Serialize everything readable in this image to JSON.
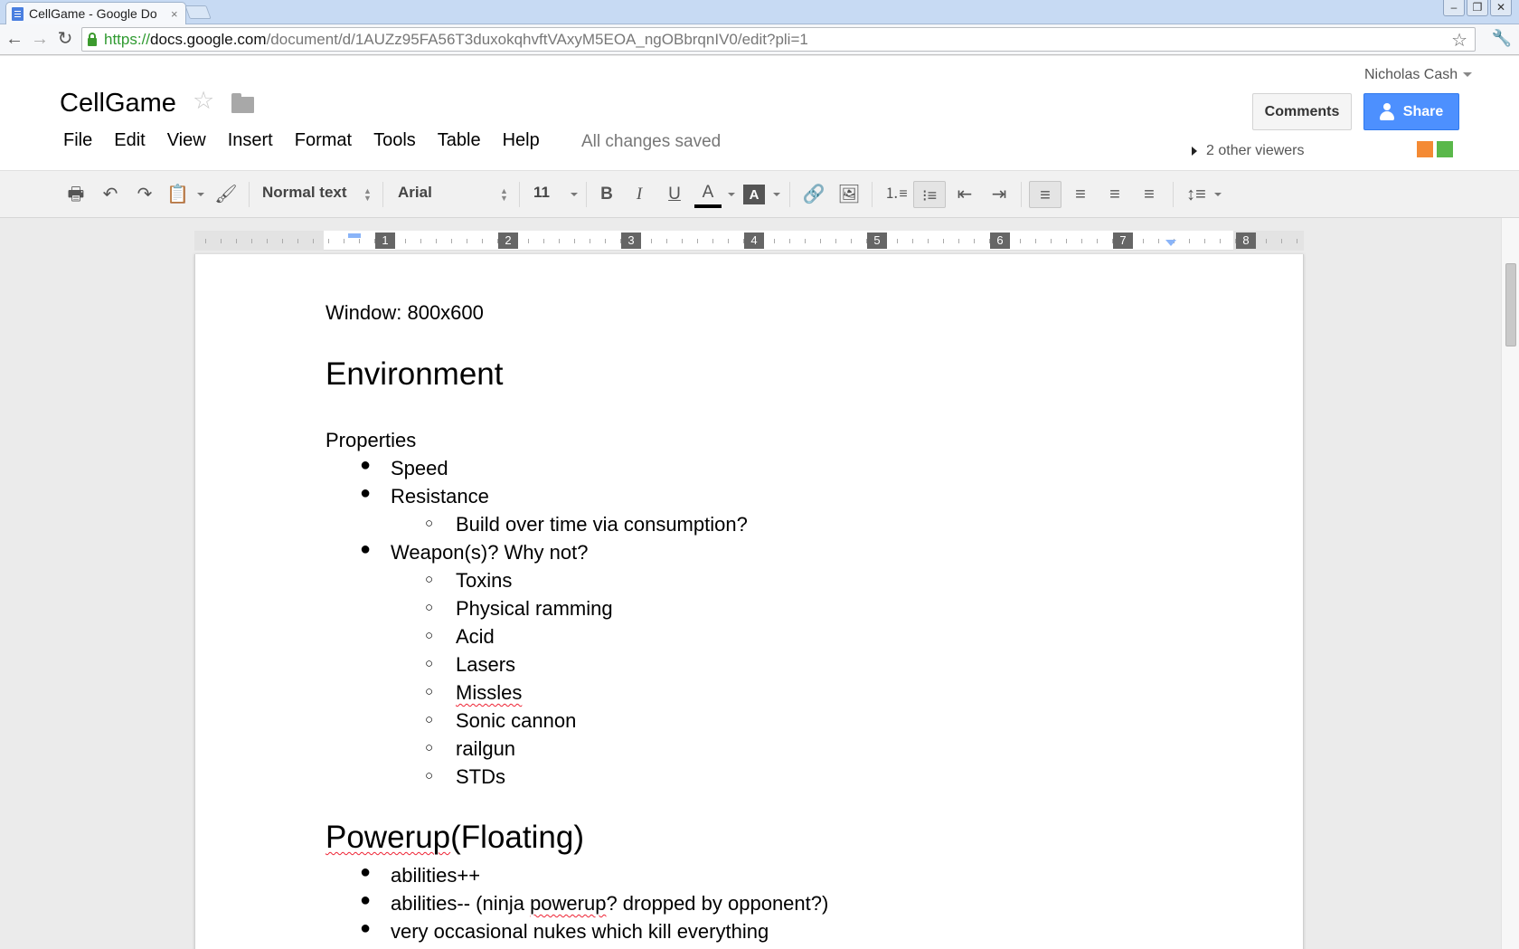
{
  "browser": {
    "tab_title": "CellGame - Google Do",
    "tab_close": "×",
    "url_scheme": "https://",
    "url_host": "docs.google.com",
    "url_path": "/document/d/1AUZz95FA56T3duxokqhvftVAxyM5EOA_ngOBbrqnIV0/edit?pli=1",
    "window_buttons": [
      "–",
      "❐",
      "✕"
    ]
  },
  "docs_header": {
    "title": "CellGame",
    "menu": [
      "File",
      "Edit",
      "View",
      "Insert",
      "Format",
      "Tools",
      "Table",
      "Help"
    ],
    "save_status": "All changes saved",
    "user_name": "Nicholas Cash",
    "comments_label": "Comments",
    "share_label": "Share",
    "viewers_label": "2 other viewers",
    "viewer_colors": [
      "#f48a34",
      "#5ab84a"
    ]
  },
  "toolbar": {
    "style_select": "Normal text",
    "font_select": "Arial",
    "size_select": "11",
    "bold_glyph": "B",
    "italic_glyph": "I",
    "underline_glyph": "U",
    "textcolor_glyph": "A",
    "highlight_glyph": "A"
  },
  "ruler": {
    "numbers": [
      "1",
      "2",
      "3",
      "4",
      "5",
      "6",
      "7",
      "8"
    ]
  },
  "document": {
    "line1": "Window: 800x600",
    "heading1": "Environment",
    "properties_label": "Properties",
    "bullets_env": [
      "Speed",
      "Resistance"
    ],
    "resistance_sub": [
      "Build over time via consumption?"
    ],
    "weapons_label": "Weapon(s)? Why not?",
    "weapons_sub": [
      "Toxins",
      "Physical ramming",
      "Acid",
      "Lasers",
      "Missles",
      "Sonic cannon",
      "railgun",
      "STDs"
    ],
    "heading2_a": "Powerup",
    "heading2_b": "(Floating)",
    "powerup_bullets": [
      "abilities++"
    ],
    "powerup_b2_pre": "abilities-- (ninja ",
    "powerup_b2_spell": "powerup",
    "powerup_b2_post": "? dropped by opponent?)",
    "powerup_b3": "very occasional nukes which kill everything"
  }
}
